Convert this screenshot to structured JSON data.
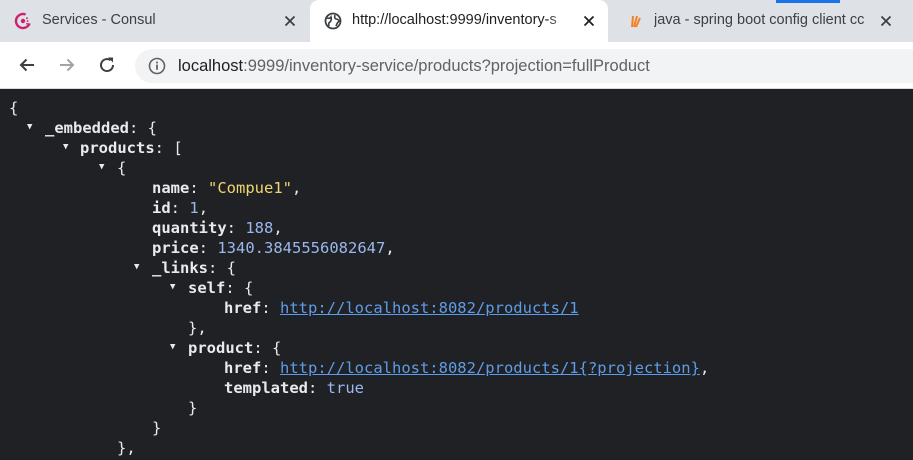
{
  "tabs": [
    {
      "title": "Services - Consul",
      "icon": "consul-icon",
      "active": false
    },
    {
      "title": "http://localhost:9999/inventory-s",
      "icon": "globe-icon",
      "active": true
    },
    {
      "title": "java - spring boot config client cc",
      "icon": "stackoverflow-icon",
      "active": false
    }
  ],
  "toolbar": {
    "url_host": "localhost",
    "url_rest": ":9999/inventory-service/products?projection=fullProduct"
  },
  "json": {
    "open_brace": "{",
    "embedded_key": "_embedded",
    "products_key": "products",
    "item_open": "{",
    "name_key": "name",
    "name_value": "\"Compue1\"",
    "id_key": "id",
    "id_value": "1",
    "quantity_key": "quantity",
    "quantity_value": "188",
    "price_key": "price",
    "price_value": "1340.3845556082647",
    "links_key": "_links",
    "self_key": "self",
    "href_key": "href",
    "self_href": "http://localhost:8082/products/1",
    "self_close": "},",
    "product_key": "product",
    "product_href": "http://localhost:8082/products/1{?projection}",
    "templated_key": "templated",
    "templated_value": "true",
    "product_close": "}",
    "links_close": "}",
    "item_close": "},"
  },
  "colors": {
    "tabstrip": "#dee1e6",
    "viewer_bg": "#202124",
    "string": "#f0d671",
    "number": "#9ab8ed",
    "link": "#5e9ce9"
  }
}
